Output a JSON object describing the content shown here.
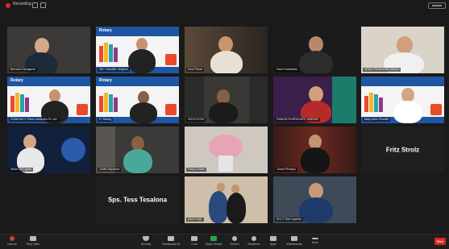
{
  "recording": {
    "label": "Recording"
  },
  "participants": [
    {
      "name": "Bernard Cartagena",
      "bg": "#3b3a38"
    },
    {
      "name": "SM. Kristoffer Jetgeba",
      "bg": "#f2f2f2"
    },
    {
      "name": "Irma Pimas",
      "bg": "#1d1d1d"
    },
    {
      "name": "Dave Karanthan",
      "bg": "#1b1b1b"
    },
    {
      "name": "ARIAS PIDRIGUEZ MAGO",
      "bg": "#d9d4c7"
    },
    {
      "name": "21080 Art H. Rizes /ambo/bo Pc. Art.",
      "bg": "#f2f2f2"
    },
    {
      "name": "H. Raring",
      "bg": "#f2f2f2"
    },
    {
      "name": "2021070709",
      "bg": "#2b2b2b"
    },
    {
      "name": "RAMON RODRIGUEZ JIMENEZ",
      "bg": "#3a1f4a"
    },
    {
      "name": "Mary Anne Rocella",
      "bg": "#f2f2f2"
    },
    {
      "name": "Maria Sol Lupas",
      "bg": "#11213c"
    },
    {
      "name": "Judith Deparina",
      "bg": "#3a3a38"
    },
    {
      "name": "Greg Lozada",
      "bg": "#cfc8c0"
    },
    {
      "name": "Jomar Pichayu",
      "bg": "#2b1a18"
    },
    {
      "name": "Fritz Strolz",
      "bg": "#1f1f1f"
    },
    {
      "name": "Sps. Tess Tesalona",
      "bg": "#1f1f1f"
    },
    {
      "name": "jason engr.",
      "bg": "#cdbfaa"
    },
    {
      "name": "W.C.T Dee Lapena",
      "bg": "#3e4a58"
    }
  ],
  "controls": {
    "mute": "Unmute",
    "video": "Stop Video",
    "security": "Security",
    "participants": "Participants",
    "participants_count": "56",
    "chat": "Chat",
    "share": "Share Screen",
    "record": "Record",
    "reactions": "Reactions",
    "apps": "Apps",
    "whiteboards": "Whiteboards",
    "more": "More",
    "end": "End"
  },
  "colors": {
    "accent_green": "#22a84a",
    "end_red": "#e02828",
    "rotary_blue": "#1f56a3"
  }
}
